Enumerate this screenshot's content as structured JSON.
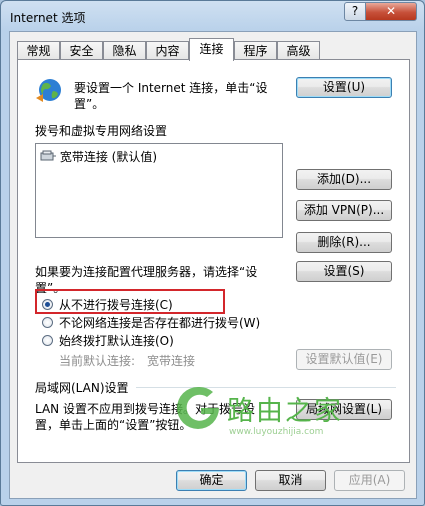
{
  "window": {
    "title": "Internet 选项",
    "help": "?",
    "close": "✕"
  },
  "tabs": [
    {
      "label": "常规",
      "active": false
    },
    {
      "label": "安全",
      "active": false
    },
    {
      "label": "隐私",
      "active": false
    },
    {
      "label": "内容",
      "active": false
    },
    {
      "label": "连接",
      "active": true
    },
    {
      "label": "程序",
      "active": false
    },
    {
      "label": "高级",
      "active": false
    }
  ],
  "setup": {
    "text_line1": "要设置一个 Internet 连接，单击“设",
    "text_line2": "置”。",
    "button": "设置(U)"
  },
  "dialup": {
    "heading": "拨号和虚拟专用网络设置",
    "items": [
      "宽带连接 (默认值)"
    ],
    "add_button": "添加(D)...",
    "add_vpn_button": "添加 VPN(P)...",
    "delete_button": "删除(R)...",
    "proxy_text_line1": "如果要为连接配置代理服务器，请选择“设",
    "proxy_text_line2": "置”。",
    "settings_button": "设置(S)",
    "radio_options": [
      {
        "label": "从不进行拨号连接(C)",
        "checked": true,
        "disabled": false
      },
      {
        "label": "不论网络连接是否存在都进行拨号(W)",
        "checked": false,
        "disabled": false
      },
      {
        "label": "始终拨打默认连接(O)",
        "checked": false,
        "disabled": false
      }
    ],
    "current_default_label": "当前默认连接:",
    "current_default_value": "宽带连接",
    "set_default_button": "设置默认值(E)"
  },
  "lan": {
    "heading": "局域网(LAN)设置",
    "text_line1": "LAN 设置不应用到拨号连接。对于拨号设",
    "text_line2": "置，单击上面的“设置”按钮。",
    "button": "局域网设置(L)"
  },
  "footer": {
    "ok": "确定",
    "cancel": "取消",
    "apply": "应用(A)"
  },
  "watermark": {
    "text": "路由之家",
    "url": "www.luyouzhijia.com"
  },
  "colors": {
    "highlight_border": "#d3262b",
    "watermark": "#56b44b",
    "accent": "#3c7fb1"
  }
}
